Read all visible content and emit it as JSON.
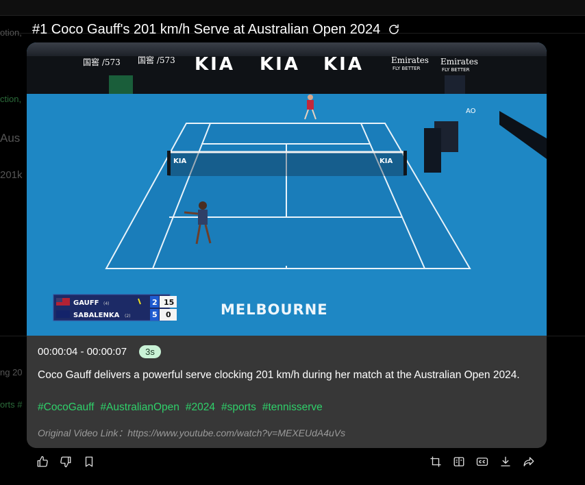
{
  "title": "#1 Coco Gauff's 201 km/h Serve at Australian Open 2024",
  "background": {
    "snippets": [
      "otion,",
      "Aus",
      "201k",
      "ction,",
      "ng 20",
      "orts #"
    ]
  },
  "video": {
    "sponsors": [
      "KIA",
      "KIA",
      "KIA"
    ],
    "emirates": [
      "Emirates",
      "FLY BETTER"
    ],
    "court_text": "MELBOURNE",
    "scoreboard": {
      "players": [
        {
          "name": "GAUFF",
          "seed": "(4)",
          "sets": "2",
          "points": "15"
        },
        {
          "name": "SABALENKA",
          "seed": "(2)",
          "sets": "5",
          "points": "0"
        }
      ]
    }
  },
  "clip": {
    "time_range": "00:00:04 - 00:00:07",
    "duration": "3s",
    "description": "Coco Gauff delivers a powerful serve clocking 201 km/h during her match at the Australian Open 2024.",
    "tags": [
      "#CocoGauff",
      "#AustralianOpen",
      "#2024",
      "#sports",
      "#tennisserve"
    ],
    "link_label": "Original Video Link：",
    "link_url": "https://www.youtube.com/watch?v=MEXEUdA4uVs"
  },
  "toolbar": {
    "left": [
      "thumbs-up-icon",
      "thumbs-down-icon",
      "bookmark-icon"
    ],
    "right": [
      "crop-icon",
      "split-icon",
      "captions-icon",
      "download-icon",
      "share-icon"
    ]
  },
  "colors": {
    "accent_green": "#2fd06a",
    "card_bg": "#373737",
    "court_blue": "#1d83bf"
  }
}
